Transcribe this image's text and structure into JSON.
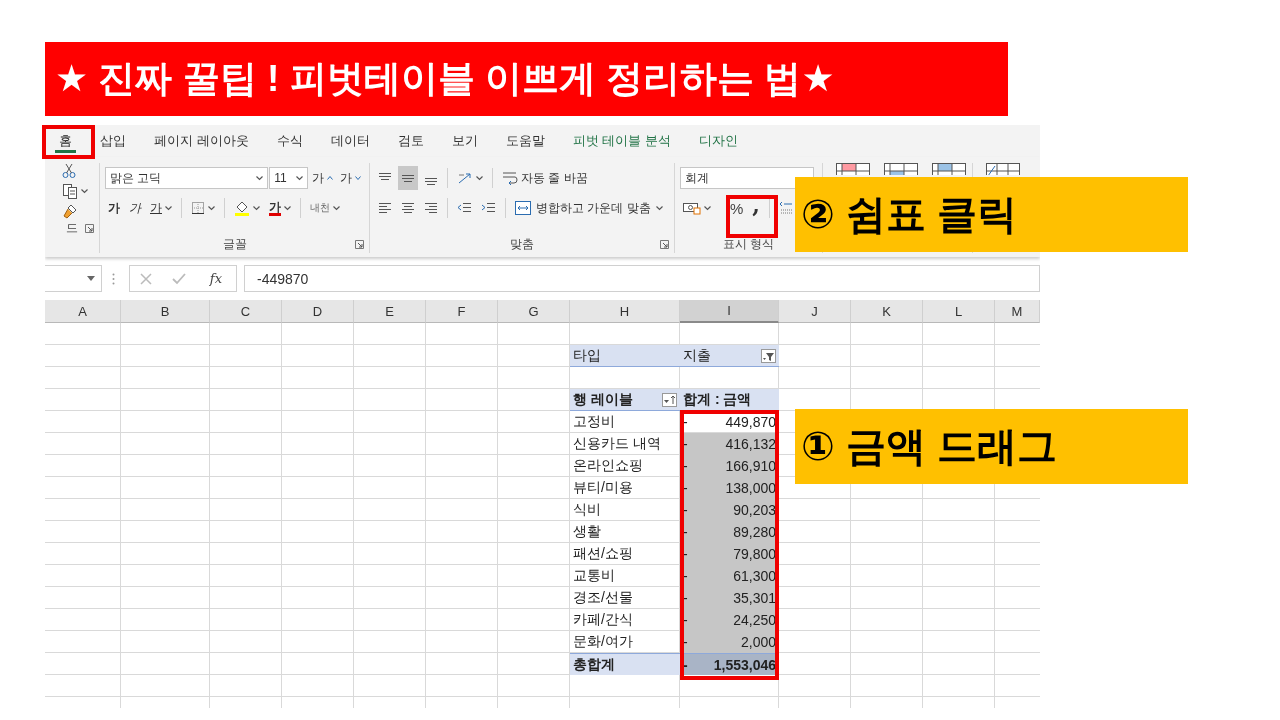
{
  "banner": {
    "title": "★ 진짜 꿀팁 ! 피벗테이블 이쁘게 정리하는 법★"
  },
  "ribbon": {
    "tabs": [
      {
        "label": "홈",
        "selected": true,
        "kind": "normal"
      },
      {
        "label": "삽입",
        "selected": false,
        "kind": "normal"
      },
      {
        "label": "페이지 레이아웃",
        "selected": false,
        "kind": "normal"
      },
      {
        "label": "수식",
        "selected": false,
        "kind": "normal"
      },
      {
        "label": "데이터",
        "selected": false,
        "kind": "normal"
      },
      {
        "label": "검토",
        "selected": false,
        "kind": "normal"
      },
      {
        "label": "보기",
        "selected": false,
        "kind": "normal"
      },
      {
        "label": "도움말",
        "selected": false,
        "kind": "normal"
      },
      {
        "label": "피벗 테이블 분석",
        "selected": false,
        "kind": "contextual"
      },
      {
        "label": "디자인",
        "selected": false,
        "kind": "contextual"
      }
    ],
    "clipboard": {
      "label": "드"
    },
    "font": {
      "label": "글꼴",
      "name": "맑은 고딕",
      "size": "11",
      "grow": "가",
      "shrink": "가",
      "bold": "가",
      "italic": "가",
      "underline": "가",
      "font_color_label": "가",
      "phonetic": "내천"
    },
    "alignment": {
      "label": "맞춤",
      "vertical": [
        {
          "selected": false
        },
        {
          "selected": true
        },
        {
          "selected": false
        }
      ],
      "wrap": "자동 줄 바꿈",
      "merge": "병합하고 가운데 맞춤"
    },
    "number": {
      "label": "표시 형식",
      "format": "회계",
      "percent": "%",
      "comma": ","
    }
  },
  "formula_bar": {
    "function": "fx",
    "value": "-449870"
  },
  "columns": [
    {
      "label": "A",
      "selected": false
    },
    {
      "label": "B",
      "selected": false
    },
    {
      "label": "C",
      "selected": false
    },
    {
      "label": "D",
      "selected": false
    },
    {
      "label": "E",
      "selected": false
    },
    {
      "label": "F",
      "selected": false
    },
    {
      "label": "G",
      "selected": false
    },
    {
      "label": "H",
      "selected": false
    },
    {
      "label": "I",
      "selected": true
    },
    {
      "label": "J",
      "selected": false
    },
    {
      "label": "K",
      "selected": false
    },
    {
      "label": "L",
      "selected": false
    },
    {
      "label": "M",
      "selected": false
    }
  ],
  "pivot": {
    "filter": {
      "label": "타입",
      "value": "지출"
    },
    "header": {
      "row_label": "행 레이블",
      "value_label": "합계 : 금액"
    },
    "rows": [
      {
        "label": "고정비",
        "sign": "-",
        "value": "449,870",
        "selected": false
      },
      {
        "label": "신용카드 내역",
        "sign": "-",
        "value": "416,132",
        "selected": true
      },
      {
        "label": "온라인쇼핑",
        "sign": "-",
        "value": "166,910",
        "selected": true
      },
      {
        "label": "뷰티/미용",
        "sign": "-",
        "value": "138,000",
        "selected": true
      },
      {
        "label": "식비",
        "sign": "-",
        "value": "90,203",
        "selected": true
      },
      {
        "label": "생활",
        "sign": "-",
        "value": "89,280",
        "selected": true
      },
      {
        "label": "패션/쇼핑",
        "sign": "-",
        "value": "79,800",
        "selected": true
      },
      {
        "label": "교통비",
        "sign": "-",
        "value": "61,300",
        "selected": true
      },
      {
        "label": "경조/선물",
        "sign": "-",
        "value": "35,301",
        "selected": true
      },
      {
        "label": "카페/간식",
        "sign": "-",
        "value": "24,250",
        "selected": true
      },
      {
        "label": "문화/여가",
        "sign": "-",
        "value": "2,000",
        "selected": true
      }
    ],
    "total": {
      "label": "총합계",
      "sign": "-",
      "value": "1,553,046",
      "selected": true
    }
  },
  "callouts": [
    {
      "text": "② 쉼표 클릭"
    },
    {
      "text": "① 금액 드래그"
    }
  ]
}
